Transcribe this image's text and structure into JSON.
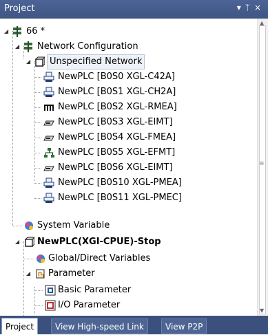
{
  "panel": {
    "title": "Project",
    "pin_icon": "pin-icon",
    "close_icon": "close-icon"
  },
  "tree": {
    "root": "66 *",
    "network_config": "Network Configuration",
    "unspecified_network": "Unspecified Network",
    "plcs": [
      "NewPLC [B0S0 XGL-C42A]",
      "NewPLC [B0S1 XGL-CH2A]",
      "NewPLC [B0S2 XGL-RMEA]",
      "NewPLC [B0S3 XGL-EIMT]",
      "NewPLC [B0S4 XGL-FMEA]",
      "NewPLC [B0S5 XGL-EFMT]",
      "NewPLC [B0S6 XGL-EIMT]",
      "NewPLC [B0S10 XGL-PMEA]",
      "NewPLC [B0S11 XGL-PMEC]"
    ],
    "system_variable": "System Variable",
    "cpu": "NewPLC(XGI-CPUE)-Stop",
    "global_vars": "Global/Direct Variables",
    "parameter": "Parameter",
    "basic_param": "Basic Parameter",
    "io_param": "I/O Parameter"
  },
  "tabs": [
    "Project",
    "View High-speed Link",
    "View P2P"
  ]
}
